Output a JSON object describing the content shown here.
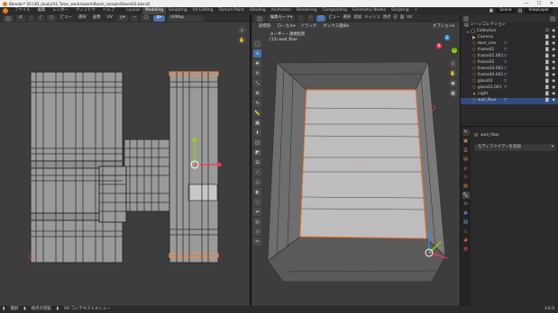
{
  "window": {
    "title": "Blender* [D:\\3D_study\\03_Tutor_works\\work\\Room_sample\\Room03.blend]",
    "controls": [
      "—",
      "☐",
      "✕"
    ]
  },
  "menu": {
    "items": [
      "ファイル",
      "編集",
      "レンダー",
      "ウィンドウ",
      "ヘルプ"
    ],
    "workspaces": [
      "Layout",
      "Modeling",
      "Sculpting",
      "UV Editing",
      "Texture Paint",
      "Shading",
      "Animation",
      "Rendering",
      "Compositing",
      "Geometry Nodes",
      "Scripting",
      "+"
    ],
    "active_workspace": "Modeling",
    "scene": "Scene",
    "view_layer": "ViewLayer"
  },
  "uv_header": {
    "mode": "UV エディター",
    "menus": [
      "ビュー",
      "選択",
      "画像",
      "UV"
    ],
    "image_name": "UVMap"
  },
  "viewport_header": {
    "mode": "編集モード",
    "menus": [
      "ビュー",
      "選択",
      "追加",
      "メッシュ",
      "頂点",
      "辺",
      "面",
      "UV"
    ],
    "transform_orientation": "ローカル",
    "pivot": "ボックス選択",
    "coord_label": "座標系:",
    "drag_label": "ドラッグ:",
    "options": "オプション"
  },
  "viewport": {
    "view_name": "ユーザー・透視投影",
    "object_info": "(13) wall_floor",
    "axis_labels": {
      "x": "X",
      "y": "Y",
      "z": "Z"
    },
    "colors": {
      "background": "#3d3d3d",
      "face": "#bdbdbd",
      "selected_edge": "#ff7a2a",
      "x_axis": "#ff3352",
      "y_axis": "#8bdc00",
      "z_axis": "#2c8fff"
    }
  },
  "uv_view": {
    "colors": {
      "background": "#3d3d3d",
      "island": "#9a9a9a",
      "island_edge": "#2a2a2a",
      "selected": "#ff8a3a",
      "selected_face": "#c8c8c8"
    }
  },
  "outliner": {
    "title": "シーンコレクション",
    "collection": "Collection",
    "items": [
      {
        "name": "Camera",
        "icon": "camera-icon",
        "selected": false
      },
      {
        "name": "door_one",
        "icon": "mesh-icon",
        "selected": false
      },
      {
        "name": "frame01",
        "icon": "mesh-icon",
        "selected": false
      },
      {
        "name": "frame01.001",
        "icon": "mesh-icon",
        "selected": false
      },
      {
        "name": "frame02",
        "icon": "mesh-icon",
        "selected": false
      },
      {
        "name": "frame03.001",
        "icon": "mesh-icon",
        "selected": false
      },
      {
        "name": "frame04.001",
        "icon": "mesh-icon",
        "selected": false
      },
      {
        "name": "glass01",
        "icon": "mesh-icon",
        "selected": false
      },
      {
        "name": "glass01.001",
        "icon": "mesh-icon",
        "selected": false
      },
      {
        "name": "Light",
        "icon": "light-icon",
        "selected": false
      },
      {
        "name": "wall_floor",
        "icon": "mesh-icon",
        "selected": true
      }
    ]
  },
  "properties": {
    "object_name": "wall_floor",
    "add_modifier": "モディファイアーを追加",
    "tabs": [
      "tool-tab",
      "render-tab",
      "output-tab",
      "view-layer-tab",
      "scene-tab",
      "world-tab",
      "object-tab",
      "modifier-tab",
      "particles-tab",
      "physics-tab",
      "constraints-tab",
      "data-tab",
      "material-tab",
      "texture-tab"
    ]
  },
  "statusbar": {
    "items": [
      "選択",
      "視点の回転",
      "UV コンテキストメニュー"
    ],
    "version": "3.6.0"
  }
}
